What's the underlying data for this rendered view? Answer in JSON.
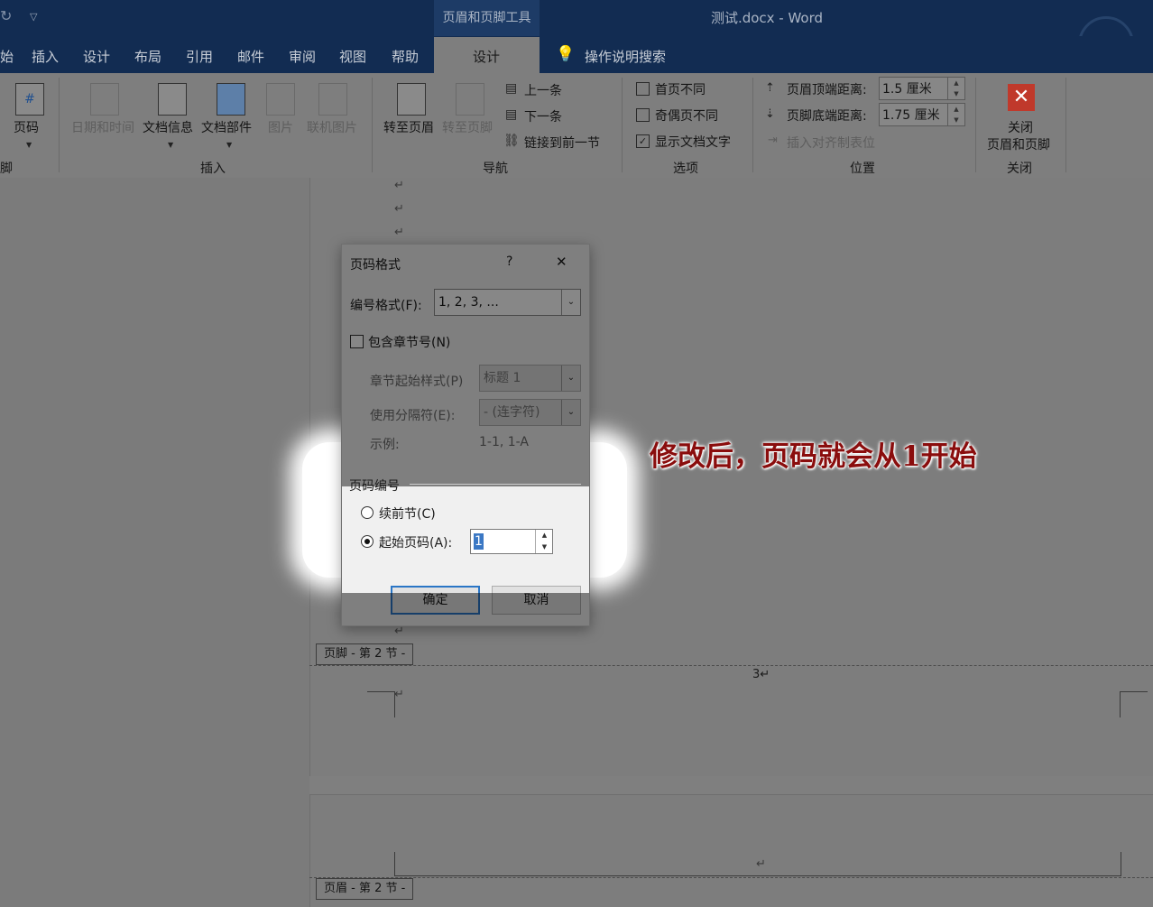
{
  "window": {
    "context_tab_group": "页眉和页脚工具",
    "document_title": "测试.docx  -  Word"
  },
  "ribbon_tabs": [
    "始",
    "插入",
    "设计",
    "布局",
    "引用",
    "邮件",
    "审阅",
    "视图",
    "帮助"
  ],
  "active_context_tab": "设计",
  "tell_me": "操作说明搜索",
  "ribbon": {
    "page_number": "页码",
    "group_header_footer": "脚",
    "date_time": "日期和时间",
    "doc_info": "文档信息",
    "doc_parts": "文档部件",
    "picture": "图片",
    "online_picture": "联机图片",
    "group_insert": "插入",
    "goto_header": "转至页眉",
    "goto_footer": "转至页脚",
    "prev": "上一条",
    "next": "下一条",
    "link_prev": "链接到前一节",
    "group_nav": "导航",
    "diff_first": "首页不同",
    "diff_odd_even": "奇偶页不同",
    "show_doc_text": "显示文档文字",
    "group_options": "选项",
    "header_top_label": "页眉顶端距离:",
    "header_top_value": "1.5 厘米",
    "footer_bottom_label": "页脚底端距离:",
    "footer_bottom_value": "1.75 厘米",
    "insert_align_tab": "插入对齐制表位",
    "group_position": "位置",
    "close_line1": "关闭",
    "close_line2": "页眉和页脚",
    "group_close": "关闭"
  },
  "document": {
    "para_mark": "↵",
    "footer_tag": "页脚 - 第 2 节 -",
    "header_tag": "页眉 - 第 2 节 -",
    "page_number_shown": "3↵"
  },
  "dialog": {
    "title": "页码格式",
    "help": "?",
    "close": "✕",
    "number_format_label": "编号格式(F):",
    "number_format_value": "1, 2, 3, ...",
    "include_chapter_label": "包含章节号(N)",
    "chapter_style_label": "章节起始样式(P)",
    "chapter_style_value": "标题 1",
    "separator_label": "使用分隔符(E):",
    "separator_value": "-  (连字符)",
    "example_label": "示例:",
    "example_value": "1-1, 1-A",
    "numbering_section": "页码编号",
    "continue_label": "续前节(C)",
    "start_at_label": "起始页码(A):",
    "start_at_value": "1",
    "ok": "确定",
    "cancel": "取消"
  },
  "annotation": "修改后，页码就会从1开始"
}
